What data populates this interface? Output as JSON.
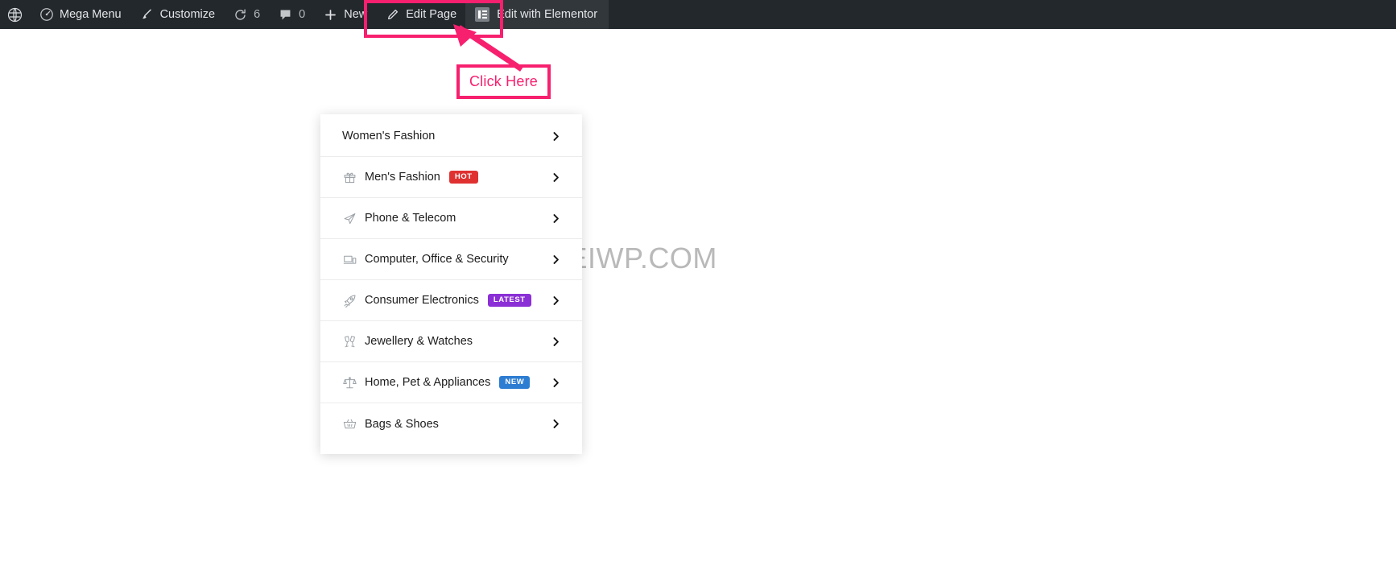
{
  "admin_bar": {
    "background": "#23282d",
    "items": [
      {
        "id": "wp-logo",
        "icon": "wordpress-icon",
        "label": "",
        "count": ""
      },
      {
        "id": "mega-menu",
        "icon": "dashboard-icon",
        "label": "Mega Menu",
        "count": ""
      },
      {
        "id": "customize",
        "icon": "paintbrush-icon",
        "label": "Customize",
        "count": ""
      },
      {
        "id": "updates",
        "icon": "update-icon",
        "label": "",
        "count": "6"
      },
      {
        "id": "comments",
        "icon": "comment-icon",
        "label": "",
        "count": "0"
      },
      {
        "id": "new",
        "icon": "plus-icon",
        "label": "New",
        "count": ""
      },
      {
        "id": "edit-page",
        "icon": "pencil-icon",
        "label": "Edit Page",
        "count": ""
      },
      {
        "id": "elementor",
        "icon": "elementor-icon",
        "label": "Edit with Elementor",
        "count": ""
      }
    ]
  },
  "annotation": {
    "color": "#f7206f",
    "callout_label": "Click Here",
    "highlight_target": "Edit with Elementor"
  },
  "watermark": {
    "text": "HEIWP.COM",
    "color": "#b9b9b9"
  },
  "mega_menu": {
    "items": [
      {
        "label": "Women's Fashion",
        "icon": "none",
        "badge": null,
        "badge_color": null,
        "chevron": "chevron-right-icon"
      },
      {
        "label": "Men's Fashion",
        "icon": "gift-icon",
        "badge": "HOT",
        "badge_color": "#e03131",
        "chevron": "chevron-right-icon"
      },
      {
        "label": "Phone & Telecom",
        "icon": "paper-plane-icon",
        "badge": null,
        "badge_color": null,
        "chevron": "chevron-right-icon"
      },
      {
        "label": "Computer, Office & Security",
        "icon": "laptop-icon",
        "badge": null,
        "badge_color": null,
        "chevron": "chevron-right-icon"
      },
      {
        "label": "Consumer Electronics",
        "icon": "rocket-icon",
        "badge": "LATEST",
        "badge_color": "#8b2fd6",
        "chevron": "chevron-right-icon"
      },
      {
        "label": "Jewellery & Watches",
        "icon": "champagne-glasses-icon",
        "badge": null,
        "badge_color": null,
        "chevron": "chevron-right-icon"
      },
      {
        "label": "Home, Pet & Appliances",
        "icon": "balance-scale-icon",
        "badge": "NEW",
        "badge_color": "#2d7dd2",
        "chevron": "chevron-right-icon"
      },
      {
        "label": "Bags & Shoes",
        "icon": "basket-icon",
        "badge": null,
        "badge_color": null,
        "chevron": "chevron-right-icon"
      }
    ]
  }
}
